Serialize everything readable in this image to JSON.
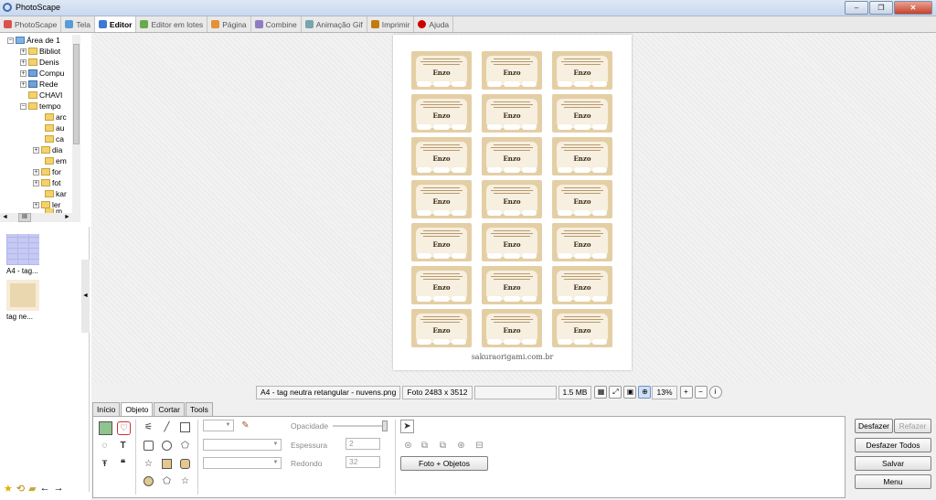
{
  "window": {
    "title": "PhotoScape",
    "min_label": "‒",
    "max_label": "❐",
    "close_label": "✕"
  },
  "tabs": [
    {
      "label": "PhotoScape",
      "color": "#d9534f"
    },
    {
      "label": "Tela",
      "color": "#5b9bd5"
    },
    {
      "label": "Editor",
      "color": "#3c78d8"
    },
    {
      "label": "Editor em lotes",
      "color": "#6aa84f"
    },
    {
      "label": "Página",
      "color": "#e69138"
    },
    {
      "label": "Combine",
      "color": "#8e7cc3"
    },
    {
      "label": "Animação Gif",
      "color": "#76a5af"
    },
    {
      "label": "Imprimir",
      "color": "#c27c0e"
    },
    {
      "label": "Ajuda",
      "color": "#cc0000"
    }
  ],
  "tree": {
    "items": [
      "Área de 1",
      "Bibliot",
      "Denis",
      "Compu",
      "Rede",
      "CHAVI",
      "tempo",
      "arc",
      "au",
      "ca",
      "dia",
      "em",
      "for",
      "fot",
      "kar",
      "ler",
      "m"
    ],
    "hscroll_label": "III"
  },
  "thumbs": [
    {
      "label": "A4 - tag..."
    },
    {
      "label": "tag ne..."
    }
  ],
  "document": {
    "tag_name": "Enzo",
    "credit": "sakuraorigami.com.br"
  },
  "status": {
    "filename": "A4 - tag neutra retangular - nuvens.png",
    "dimensions": "Foto 2483 x 3512",
    "empty": "",
    "size": "1.5 MB",
    "zoom": "13%"
  },
  "tool_tabs": [
    "Início",
    "Objeto",
    "Cortar",
    "Tools"
  ],
  "object_panel": {
    "opacity_label": "Opacidade",
    "thickness_label": "Espessura",
    "thickness_value": "2",
    "round_label": "Redondo",
    "round_value": "32",
    "photo_objects_button": "Foto + Objetos"
  },
  "right_buttons": {
    "undo": "Desfazer",
    "redo": "Refazer",
    "undo_all": "Desfazer Todos",
    "save": "Salvar",
    "menu": "Menu"
  },
  "colors": {
    "accent": "#3c78d8",
    "tag_border": "#e4cfa5",
    "tag_inner": "#f7efdf"
  }
}
